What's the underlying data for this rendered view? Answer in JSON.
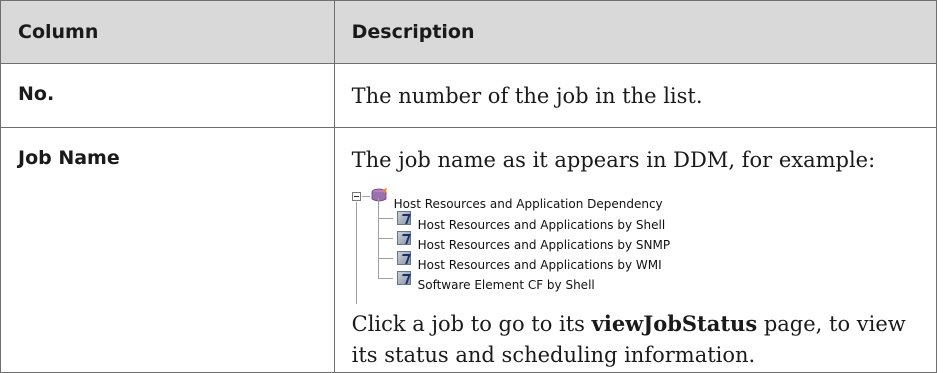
{
  "table": {
    "header": {
      "column": "Column",
      "description": "Description"
    },
    "rows": [
      {
        "name": "No.",
        "description": "The number of the job in the list."
      },
      {
        "name": "Job Name",
        "intro": "The job name as it appears in DDM, for example:",
        "tree": {
          "root": {
            "label": "Host Resources and Application Dependency",
            "icon": "job-group-icon"
          },
          "children": [
            {
              "label": "Host Resources and Applications by Shell",
              "icon": "job-icon"
            },
            {
              "label": "Host Resources and Applications by SNMP",
              "icon": "job-icon"
            },
            {
              "label": "Host Resources and Applications by WMI",
              "icon": "job-icon"
            },
            {
              "label": "Software Element CF by Shell",
              "icon": "job-icon"
            }
          ]
        },
        "outro": {
          "before": "Click a job to go to its ",
          "bold": "viewJobStatus",
          "after": " page, to view its status and scheduling information."
        }
      }
    ]
  }
}
